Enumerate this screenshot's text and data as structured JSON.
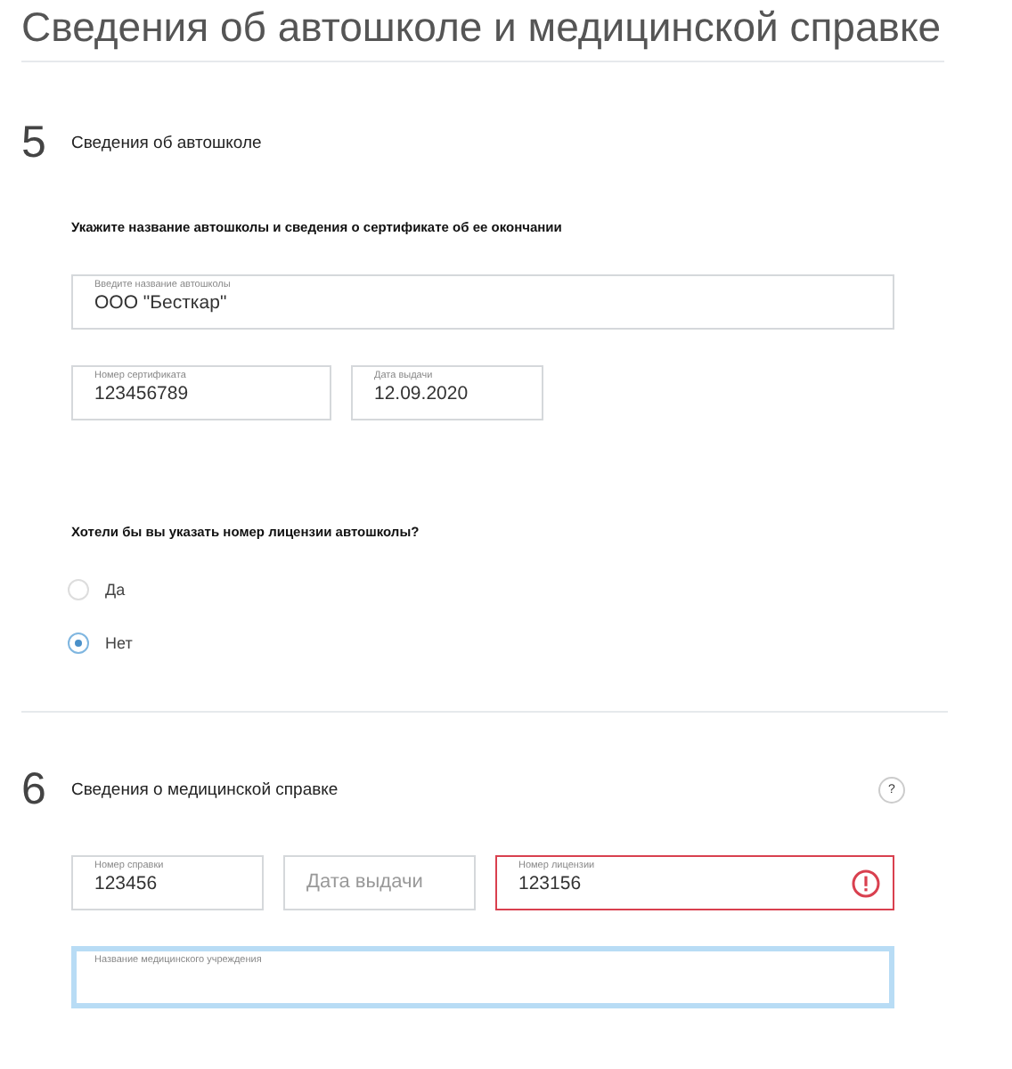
{
  "title": "Сведения об автошколе и медицинской справке",
  "sections": [
    {
      "number": "5",
      "heading": "Сведения об автошколе",
      "help": false,
      "instruction": "Укажите название автошколы и сведения о сертификате об ее окончании",
      "field_rows": [
        [
          {
            "label": "Введите название автошколы",
            "value": "ООО \"Бесткар\"",
            "error": false,
            "focused": false
          }
        ],
        [
          {
            "label": "Номер сертификата",
            "value": "123456789",
            "error": false,
            "focused": false
          },
          {
            "label": "Дата выдачи",
            "value": "12.09.2020",
            "error": false,
            "focused": false
          }
        ]
      ],
      "question": "Хотели бы вы указать номер лицензии автошколы?",
      "options": [
        {
          "label": "Да",
          "selected": false
        },
        {
          "label": "Нет",
          "selected": true
        }
      ]
    },
    {
      "number": "6",
      "heading": "Сведения о медицинской справке",
      "help": true,
      "help_label": "?",
      "field_rows": [
        [
          {
            "label": "Номер справки",
            "value": "123456",
            "error": false,
            "focused": false
          },
          {
            "placeholder": "Дата выдачи",
            "error": false,
            "focused": false
          },
          {
            "label": "Номер лицензии",
            "value": "123156",
            "error": true,
            "focused": false
          }
        ],
        [
          {
            "label": "Название медицинского учреждения",
            "error": false,
            "focused": true
          }
        ]
      ]
    }
  ]
}
